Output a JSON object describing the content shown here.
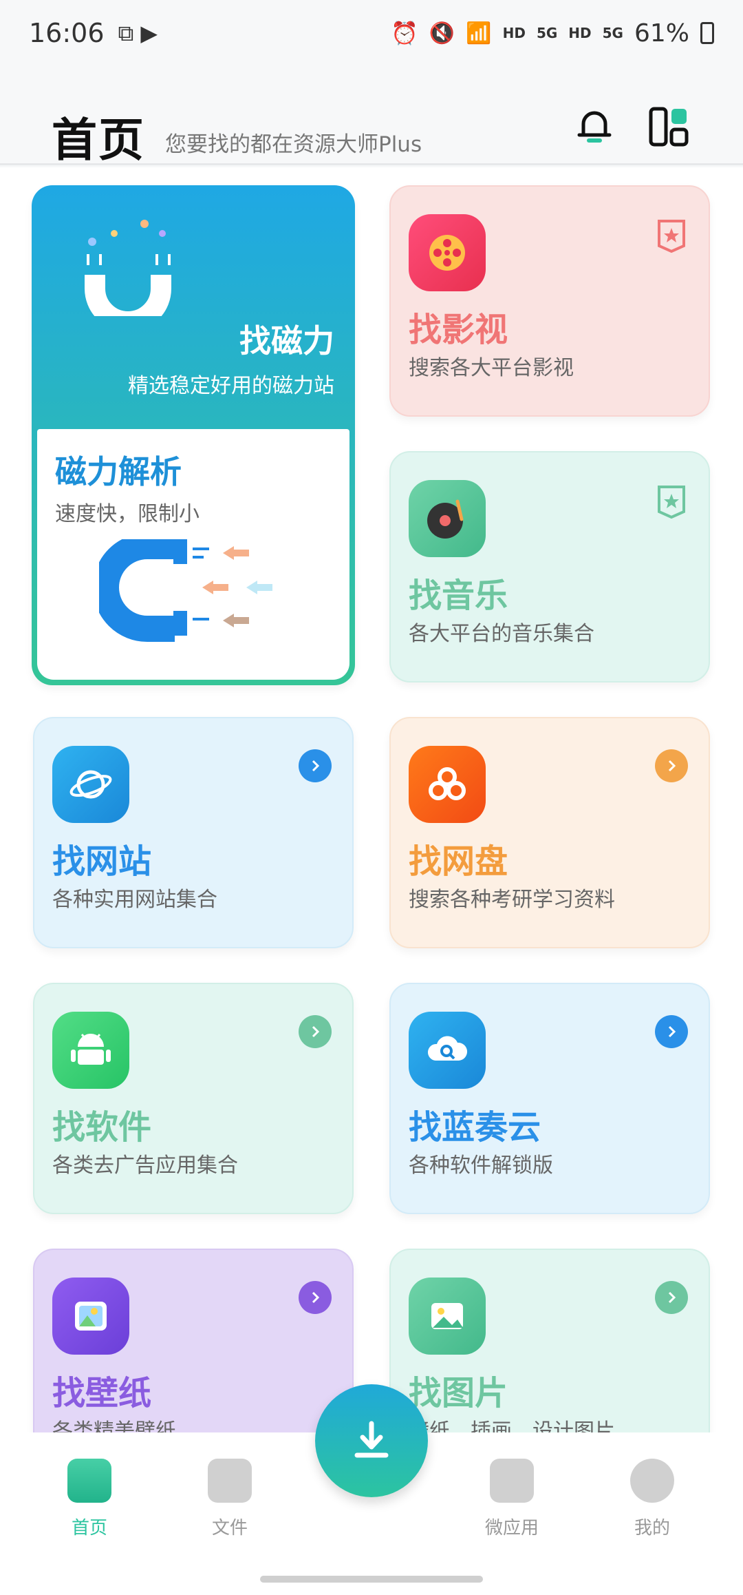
{
  "status": {
    "time": "16:06",
    "net1": "HD",
    "net2": "5G",
    "net3": "HD",
    "net4": "5G",
    "battery": "61%"
  },
  "header": {
    "title": "首页",
    "subtitle": "您要找的都在资源大师Plus"
  },
  "cards": {
    "magnet": {
      "title": "找磁力",
      "desc": "精选稳定好用的磁力站",
      "parse_title": "磁力解析",
      "parse_desc": "速度快，限制小"
    },
    "video": {
      "name": "找影视",
      "desc": "搜索各大平台影视"
    },
    "music": {
      "name": "找音乐",
      "desc": "各大平台的音乐集合"
    },
    "website": {
      "name": "找网站",
      "desc": "各种实用网站集合"
    },
    "netdisk": {
      "name": "找网盘",
      "desc": "搜索各种考研学习资料"
    },
    "software": {
      "name": "找软件",
      "desc": "各类去广告应用集合"
    },
    "lanzou": {
      "name": "找蓝奏云",
      "desc": "各种软件解锁版"
    },
    "wallpaper": {
      "name": "找壁纸",
      "desc": "各类精美壁纸"
    },
    "pictures": {
      "name": "找图片",
      "desc": "壁纸、插画、设计图片"
    }
  },
  "nav": {
    "home": "首页",
    "files": "文件",
    "microapps": "微应用",
    "mine": "我的"
  },
  "colors": {
    "accent": "#2cc4a0",
    "blue": "#2a90e8",
    "red": "#f06a6a",
    "orange": "#f39c3d",
    "purple": "#8a5ce0"
  }
}
